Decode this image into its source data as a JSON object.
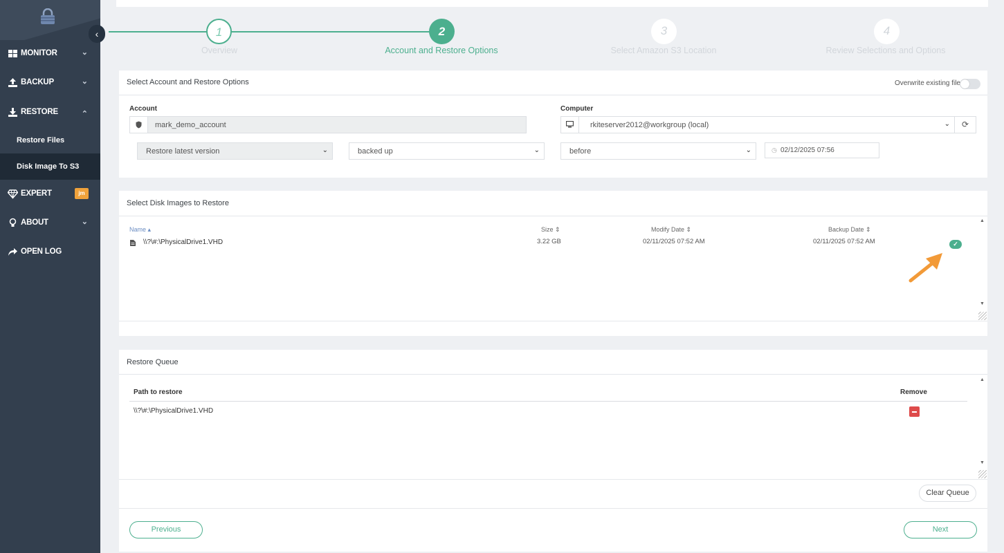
{
  "sidebar": {
    "collapse_glyph": "‹",
    "items": [
      {
        "label": "MONITOR",
        "icon": "grid-icon"
      },
      {
        "label": "BACKUP",
        "icon": "upload-icon"
      },
      {
        "label": "RESTORE",
        "icon": "download-icon"
      },
      {
        "label": "EXPERT",
        "icon": "diamond-icon",
        "badge": "jm"
      },
      {
        "label": "ABOUT",
        "icon": "bulb-icon"
      },
      {
        "label": "OPEN LOG",
        "icon": "share-arrow-icon"
      }
    ],
    "restore_sub": [
      {
        "label": "Restore Files",
        "active": false
      },
      {
        "label": "Disk Image To S3",
        "active": true
      }
    ]
  },
  "wizard": {
    "steps": [
      {
        "number": "1",
        "label": "Overview",
        "state": "done"
      },
      {
        "number": "2",
        "label": "Account and Restore Options",
        "state": "current"
      },
      {
        "number": "3",
        "label": "Select Amazon S3 Location",
        "state": "todo"
      },
      {
        "number": "4",
        "label": "Review Selections and Options",
        "state": "todo"
      }
    ]
  },
  "options_card": {
    "title": "Select Account and Restore Options",
    "overwrite_label": "Overwrite existing files",
    "account_label": "Account",
    "account_value": "mark_demo_account",
    "computer_label": "Computer",
    "computer_value": "rkiteserver2012@workgroup (local)",
    "version_select": "Restore latest version",
    "state_select": "backed up",
    "when_select": "before",
    "datetime_value": "02/12/2025 07:56"
  },
  "disk_card": {
    "title": "Select Disk Images to Restore",
    "columns": {
      "name": "Name",
      "size": "Size",
      "modify": "Modify Date",
      "backup": "Backup Date"
    },
    "rows": [
      {
        "name": "\\\\?\\#:\\PhysicalDrive1.VHD",
        "size": "3.22 GB",
        "modify": "02/11/2025 07:52 AM",
        "backup": "02/11/2025 07:52 AM",
        "selected": true
      }
    ]
  },
  "queue_card": {
    "title": "Restore Queue",
    "col_path": "Path to restore",
    "col_remove": "Remove",
    "rows": [
      {
        "path": "\\\\?\\#:\\PhysicalDrive1.VHD"
      }
    ],
    "clear_label": "Clear Queue"
  },
  "footer": {
    "previous_label": "Previous",
    "next_label": "Next"
  },
  "colors": {
    "accent": "#4caf8e",
    "sidebar": "#333f4e",
    "danger": "#de4b4b",
    "annotation_arrow": "#f29a38"
  }
}
